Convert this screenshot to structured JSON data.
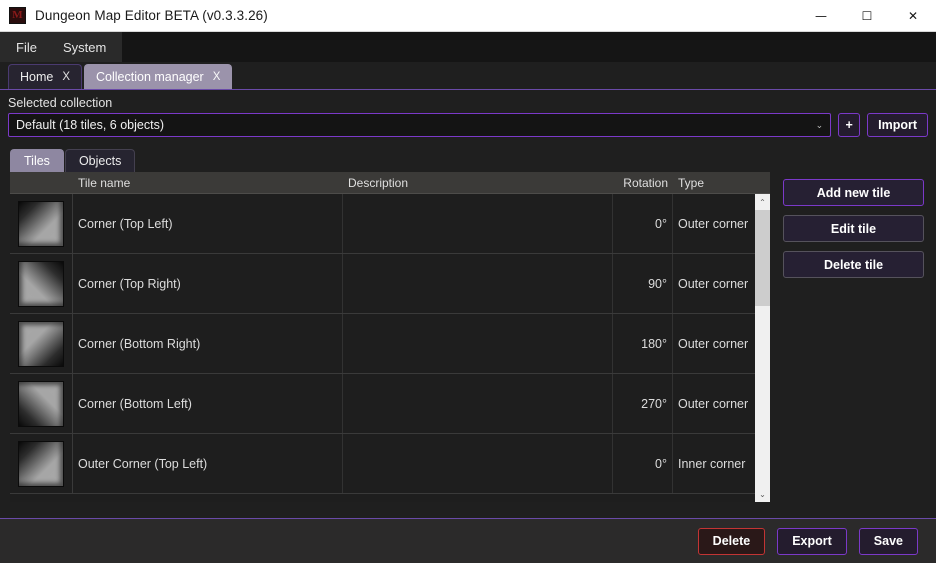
{
  "window": {
    "title": "Dungeon Map Editor BETA (v0.3.3.26)",
    "icon_glyph": "M",
    "controls": {
      "minimize": "—",
      "maximize": "☐",
      "close": "✕"
    }
  },
  "menubar": {
    "items": [
      {
        "label": "File"
      },
      {
        "label": "System"
      }
    ]
  },
  "tabs": [
    {
      "label": "Home",
      "close": "X",
      "active": false
    },
    {
      "label": "Collection manager",
      "close": "X",
      "active": true
    }
  ],
  "collection": {
    "label": "Selected collection",
    "selected": "Default (18 tiles, 6 objects)",
    "chevron": "⌄",
    "add_label": "+",
    "import_label": "Import"
  },
  "inner_tabs": [
    {
      "label": "Tiles",
      "active": true
    },
    {
      "label": "Objects",
      "active": false
    }
  ],
  "table": {
    "headers": {
      "thumb": "",
      "name": "Tile name",
      "description": "Description",
      "rotation": "Rotation",
      "type": "Type"
    },
    "rows": [
      {
        "name": "Corner (Top Left)",
        "description": "",
        "rotation": "0°",
        "type": "Outer corner",
        "thumb_rotation": 0
      },
      {
        "name": "Corner (Top Right)",
        "description": "",
        "rotation": "90°",
        "type": "Outer corner",
        "thumb_rotation": 90
      },
      {
        "name": "Corner (Bottom Right)",
        "description": "",
        "rotation": "180°",
        "type": "Outer corner",
        "thumb_rotation": 180
      },
      {
        "name": "Corner (Bottom Left)",
        "description": "",
        "rotation": "270°",
        "type": "Outer corner",
        "thumb_rotation": 270
      },
      {
        "name": "Outer Corner (Top Left)",
        "description": "",
        "rotation": "0°",
        "type": "Inner corner",
        "thumb_rotation": 0
      }
    ]
  },
  "scrollbar": {
    "up": "⌃",
    "down": "⌄"
  },
  "side_buttons": [
    {
      "label": "Add new tile",
      "primary": true
    },
    {
      "label": "Edit tile",
      "primary": false
    },
    {
      "label": "Delete tile",
      "primary": false
    }
  ],
  "bottom_buttons": [
    {
      "label": "Delete",
      "style": "danger"
    },
    {
      "label": "Export",
      "style": "primary"
    },
    {
      "label": "Save",
      "style": "primary"
    }
  ],
  "colors": {
    "accent_purple": "#7b39c9",
    "danger_red": "#c23434",
    "tab_active": "#9b93ab",
    "titlebar_bg": "#ffffff",
    "app_bg": "#1f1f1f"
  }
}
